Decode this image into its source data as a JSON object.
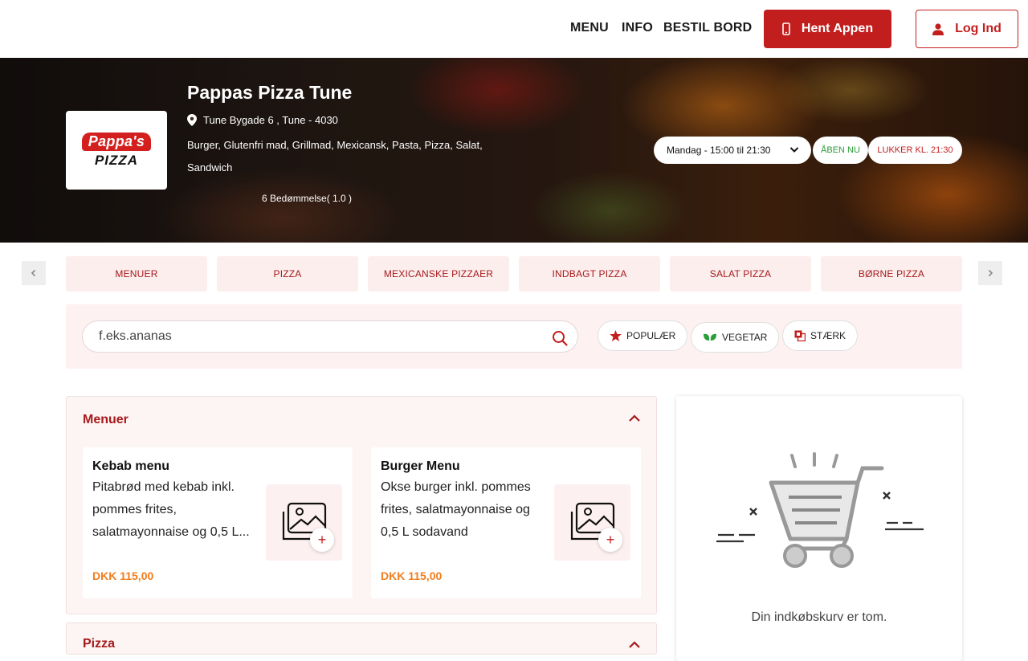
{
  "nav": {
    "menu": "MENU",
    "info": "INFO",
    "book": "BESTIL BORD",
    "app_button": "Hent Appen",
    "login_button": "Log Ind"
  },
  "restaurant": {
    "name": "Pappas Pizza Tune",
    "address": "Tune Bygade 6 , Tune - 4030",
    "cuisines": "Burger, Glutenfri mad, Grillmad, Mexicansk, Pasta, Pizza, Salat, Sandwich",
    "rating_text": "6  Bedømmelse( 1.0 )",
    "logo_top": "Pappa's",
    "logo_bottom": "PIZZA",
    "hours_selected": "Mandag - 15:00 til 21:30",
    "open_status": "ÅBEN NU",
    "close_status": "LUKKER KL. 21:30"
  },
  "categories": [
    "MENUER",
    "PIZZA",
    "MEXICANSKE PIZZAER",
    "INDBAGT PIZZA",
    "SALAT PIZZA",
    "BØRNE PIZZA"
  ],
  "search": {
    "placeholder": "f.eks.ananas"
  },
  "filters": {
    "popular": "POPULÆR",
    "vegetarian": "VEGETAR",
    "strong": "STÆRK"
  },
  "sections": [
    {
      "title": "Menuer",
      "items": [
        {
          "name": "Kebab menu",
          "description": "Pitabrød med kebab inkl. pommes frites, salatmayonnaise og 0,5 L...",
          "price": "DKK 115,00"
        },
        {
          "name": "Burger Menu",
          "description": "Okse  burger inkl. pommes frites, salatmayonnaise og 0,5 L sodavand",
          "price": "DKK 115,00"
        }
      ]
    },
    {
      "title": "Pizza"
    }
  ],
  "cart": {
    "empty_text": "Din indkøbskurv er tom."
  },
  "colors": {
    "brand_red": "#c31e1e",
    "price_orange": "#f07d1e",
    "open_green": "#2a9d3a",
    "category_bg": "#fdeeee"
  }
}
